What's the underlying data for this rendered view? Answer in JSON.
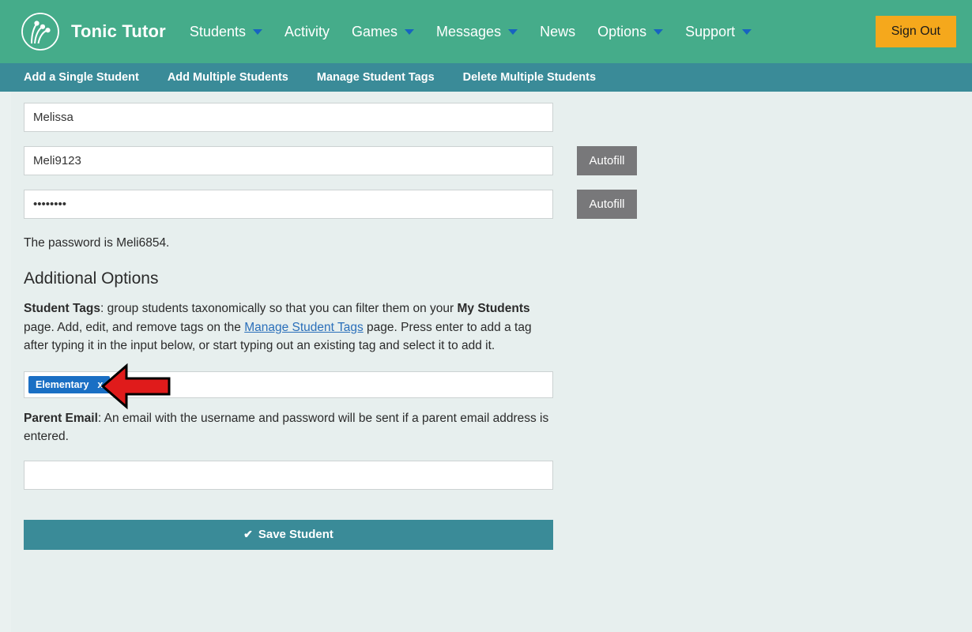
{
  "header": {
    "brand": "Tonic Tutor",
    "logo_icon": "tonic-tutor-circle-logo",
    "nav": [
      {
        "label": "Students",
        "has_caret": true
      },
      {
        "label": "Activity",
        "has_caret": false
      },
      {
        "label": "Games",
        "has_caret": true
      },
      {
        "label": "Messages",
        "has_caret": true
      },
      {
        "label": "News",
        "has_caret": false
      },
      {
        "label": "Options",
        "has_caret": true
      },
      {
        "label": "Support",
        "has_caret": true
      }
    ],
    "sign_out": "Sign Out",
    "bg_color": "#45ac8a",
    "sign_out_color": "#f5a81c",
    "caret_color": "#1763c0"
  },
  "subnav": {
    "bg_color": "#3a8b98",
    "items": [
      "Add a Single Student",
      "Add Multiple Students",
      "Manage Student Tags",
      "Delete Multiple Students"
    ]
  },
  "form": {
    "name_value": "Melissa",
    "name_placeholder": "",
    "username_value": "Meli9123",
    "username_placeholder": "",
    "password_value": "Meli6854",
    "password_placeholder": "",
    "autofill_username_label": "Autofill",
    "autofill_password_label": "Autofill",
    "password_note": "The password is Meli6854.",
    "section_title": "Additional Options",
    "student_tags": {
      "label": "Student Tags",
      "text_1": ": group students taxonomically so that you can filter them on your ",
      "bold_2": "My Students",
      "text_3": " page. Add, edit, and remove tags on the ",
      "link": "Manage Student Tags",
      "text_4": " page. Press enter to add a tag after typing it in the input below, or start typing out an existing tag and select it to add it.",
      "tags": [
        {
          "label": "Elementary",
          "remove": "x",
          "color": "#1a6fc4"
        }
      ],
      "tag_input_placeholder": ""
    },
    "parent_email": {
      "label": "Parent Email",
      "text": ": An email with the username and password will be sent if a parent email address is entered.",
      "value": "",
      "placeholder": ""
    },
    "save_button": {
      "label": "Save Student",
      "icon": "check-icon",
      "color": "#3a8b98"
    },
    "autofill_color": "#78787a"
  },
  "annotation": {
    "arrow_icon": "red-left-arrow-annotation",
    "fill": "#e01b1b",
    "stroke": "#000000",
    "points_at": "Elementary tag chip"
  },
  "page": {
    "background": "#e7efee"
  }
}
